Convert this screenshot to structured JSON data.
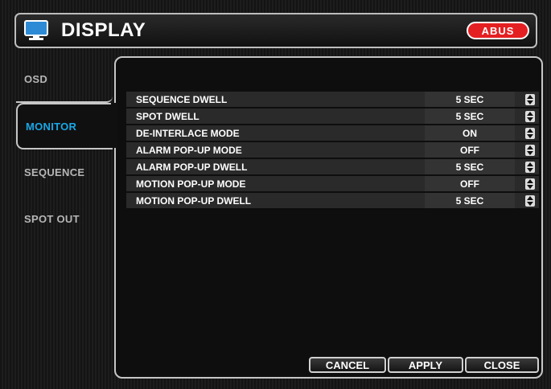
{
  "window": {
    "title": "DISPLAY",
    "logo_text": "ABUS"
  },
  "tabs": [
    {
      "label": "OSD",
      "active": false
    },
    {
      "label": "MONITOR",
      "active": true
    },
    {
      "label": "SEQUENCE",
      "active": false
    },
    {
      "label": "SPOT OUT",
      "active": false
    }
  ],
  "settings": [
    {
      "label": "SEQUENCE DWELL",
      "value": "5 SEC"
    },
    {
      "label": "SPOT DWELL",
      "value": "5 SEC"
    },
    {
      "label": "DE-INTERLACE MODE",
      "value": "ON"
    },
    {
      "label": "ALARM POP-UP MODE",
      "value": "OFF"
    },
    {
      "label": "ALARM POP-UP DWELL",
      "value": "5 SEC"
    },
    {
      "label": "MOTION POP-UP MODE",
      "value": "OFF"
    },
    {
      "label": "MOTION POP-UP DWELL",
      "value": "5 SEC"
    }
  ],
  "buttons": {
    "cancel": "CANCEL",
    "apply": "APPLY",
    "close": "CLOSE"
  },
  "colors": {
    "accent": "#19a7e6",
    "logo": "#e41f22"
  }
}
